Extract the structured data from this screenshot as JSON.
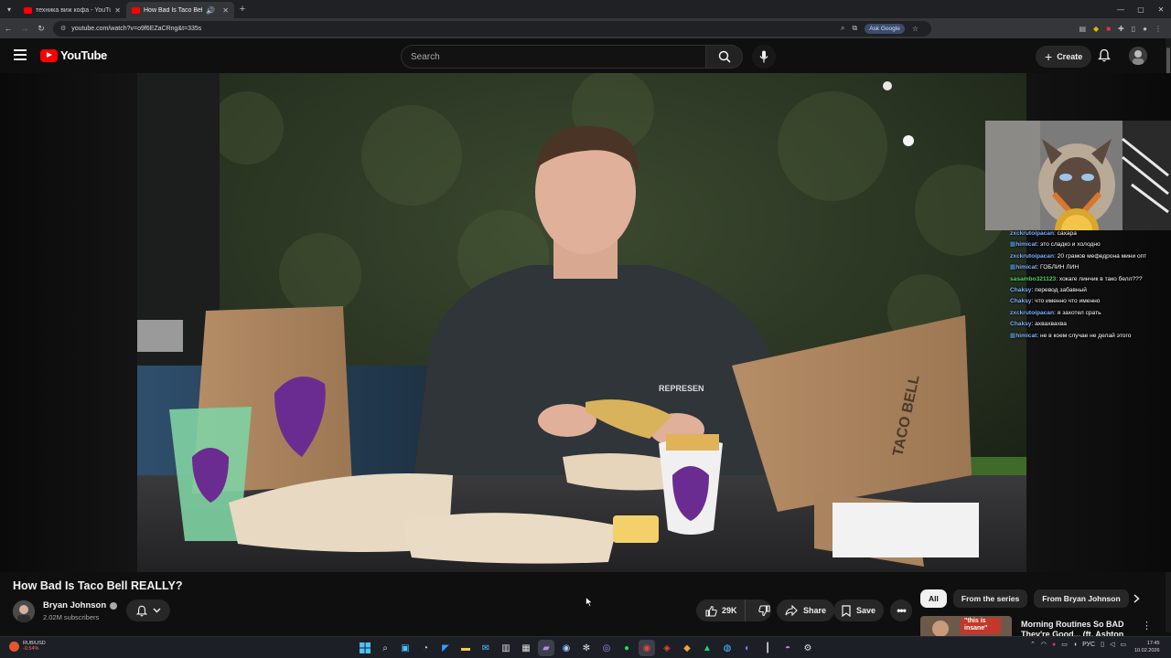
{
  "browser": {
    "tabs": [
      {
        "title": "техника виж кофа - YouTube",
        "active": false
      },
      {
        "title": "How Bad Is Taco Bell REALL",
        "active": true
      }
    ],
    "url": "youtube.com/watch?v=o9f6EZaCRng&t=335s",
    "ask_google": "Ask Google"
  },
  "youtube": {
    "logo_text": "YouTube",
    "search_placeholder": "Search",
    "create_label": "Create"
  },
  "chat": [
    {
      "user": "zxckrutoipacan",
      "text": ": сахара",
      "color": "#7fb2ff"
    },
    {
      "user": "himicat",
      "text": ": это сладко и холодно",
      "color": "#7fb2ff",
      "badge": true
    },
    {
      "user": "zxckrutoipacan",
      "text": ": 20 грамов мефедрона мини опт",
      "color": "#7fb2ff"
    },
    {
      "user": "himicat",
      "text": ": ГОБЛИН ЛИН",
      "color": "#7fb2ff",
      "badge": true
    },
    {
      "user": "sasambo321123",
      "text": ": хокаге линчик в тако белл???",
      "color": "#4cd964"
    },
    {
      "user": "Chaksy",
      "text": ": перевод забавный",
      "color": "#7fb2ff"
    },
    {
      "user": "Chaksy",
      "text": ": что именно что именно",
      "color": "#7fb2ff"
    },
    {
      "user": "zxckrutoipacan",
      "text": ": я захотел срать",
      "color": "#7fb2ff"
    },
    {
      "user": "Chaksy",
      "text": ": ахвахвахва",
      "color": "#7fb2ff"
    },
    {
      "user": "himicat",
      "text": ": не в коем случае не делай этого",
      "color": "#7fb2ff",
      "badge": true
    }
  ],
  "video": {
    "title": "How Bad Is Taco Bell REALLY?",
    "channel": "Bryan Johnson",
    "subscribers": "2.02M subscribers",
    "likes": "29K",
    "share_label": "Share",
    "save_label": "Save",
    "hoodie_text": "REPRESEN",
    "bag_text": "TACO BELL"
  },
  "chips": [
    "All",
    "From the series",
    "From Bryan Johnson"
  ],
  "recommendation": {
    "title": "Morning Routines So BAD They're Good... (ft. Ashton Hall)",
    "thumb_text": "\"this is insane\""
  },
  "taskbar": {
    "ticker_symbol": "RUB/USD",
    "ticker_change": "-0.54%",
    "lang": "РУС",
    "time": "17:45",
    "date": "10.02.2026"
  },
  "colors": {
    "youtube_red": "#ff0000",
    "background": "#0f0f0f",
    "taco_purple": "#6b2c91"
  }
}
